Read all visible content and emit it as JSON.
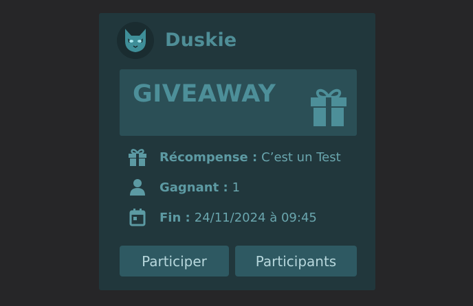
{
  "author": {
    "avatar_icon": "cat-avatar-icon",
    "name": "Duskie"
  },
  "banner": {
    "title": "GIVEAWAY",
    "icon": "gift-icon"
  },
  "fields": [
    {
      "icon": "gift-icon",
      "label": "Récompense :",
      "value": "C’est un Test"
    },
    {
      "icon": "user-icon",
      "label": "Gagnant :",
      "value": "1"
    },
    {
      "icon": "calendar-icon",
      "label": "Fin :",
      "value": "24/11/2024 à 09:45"
    }
  ],
  "buttons": {
    "join_label": "Participer",
    "participants_label": "Participants"
  },
  "colors": {
    "background": "#262628",
    "card": "#21373c",
    "accent": "#4f8e97",
    "button": "#2e5962"
  }
}
